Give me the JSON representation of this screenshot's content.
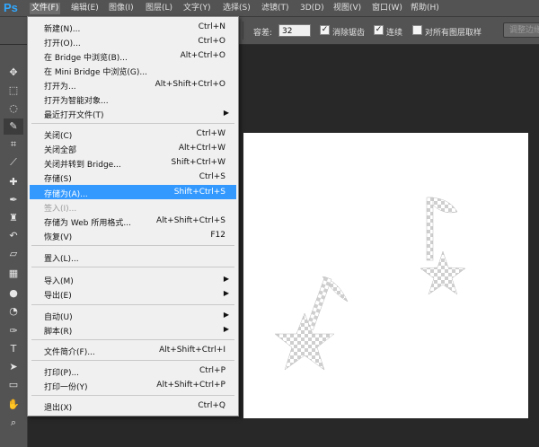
{
  "app": {
    "logo": "Ps"
  },
  "menubar": [
    "文件(F)",
    "编辑(E)",
    "图像(I)",
    "图层(L)",
    "文字(Y)",
    "选择(S)",
    "滤镜(T)",
    "3D(D)",
    "视图(V)",
    "窗口(W)",
    "帮助(H)"
  ],
  "options": {
    "tolerance_label": "容差:",
    "tolerance_value": "32",
    "antialias_label": "消除锯齿",
    "antialias_checked": true,
    "contiguous_label": "连续",
    "contiguous_checked": true,
    "sample_all_label": "对所有图层取样",
    "sample_all_checked": false,
    "refine_edge_label": "调整边缘"
  },
  "tools": [
    "move",
    "marquee",
    "lasso",
    "quick-select",
    "crop",
    "eyedropper",
    "spot-heal",
    "brush",
    "clone-stamp",
    "history-brush",
    "eraser",
    "gradient",
    "blur",
    "dodge",
    "pen",
    "type",
    "path-select",
    "rectangle",
    "hand",
    "zoom"
  ],
  "file_menu": {
    "items": [
      {
        "label": "新建(N)...",
        "shortcut": "Ctrl+N"
      },
      {
        "label": "打开(O)...",
        "shortcut": "Ctrl+O"
      },
      {
        "label": "在 Bridge 中浏览(B)...",
        "shortcut": "Alt+Ctrl+O"
      },
      {
        "label": "在 Mini Bridge 中浏览(G)...",
        "shortcut": ""
      },
      {
        "label": "打开为...",
        "shortcut": "Alt+Shift+Ctrl+O"
      },
      {
        "label": "打开为智能对象...",
        "shortcut": ""
      },
      {
        "label": "最近打开文件(T)",
        "shortcut": "▶"
      },
      {
        "label": "关闭(C)",
        "shortcut": "Ctrl+W"
      },
      {
        "label": "关闭全部",
        "shortcut": "Alt+Ctrl+W"
      },
      {
        "label": "关闭并转到 Bridge...",
        "shortcut": "Shift+Ctrl+W"
      },
      {
        "label": "存储(S)",
        "shortcut": "Ctrl+S"
      },
      {
        "label": "存储为(A)...",
        "shortcut": "Shift+Ctrl+S"
      },
      {
        "label": "签入(I)...",
        "shortcut": ""
      },
      {
        "label": "存储为 Web 所用格式...",
        "shortcut": "Alt+Shift+Ctrl+S"
      },
      {
        "label": "恢复(V)",
        "shortcut": "F12"
      },
      {
        "label": "置入(L)...",
        "shortcut": ""
      },
      {
        "label": "导入(M)",
        "shortcut": "▶"
      },
      {
        "label": "导出(E)",
        "shortcut": "▶"
      },
      {
        "label": "自动(U)",
        "shortcut": "▶"
      },
      {
        "label": "脚本(R)",
        "shortcut": "▶"
      },
      {
        "label": "文件简介(F)...",
        "shortcut": "Alt+Shift+Ctrl+I"
      },
      {
        "label": "打印(P)...",
        "shortcut": "Ctrl+P"
      },
      {
        "label": "打印一份(Y)",
        "shortcut": "Alt+Shift+Ctrl+P"
      },
      {
        "label": "退出(X)",
        "shortcut": "Ctrl+Q"
      }
    ],
    "highlighted_item": "存储为(A)...",
    "disabled_item": "签入(I)..."
  },
  "colors": {
    "highlight": "#3399ff",
    "ps_blue": "#31a8ff",
    "canvas_bg": "#282828",
    "panel_gray": "#535353"
  }
}
